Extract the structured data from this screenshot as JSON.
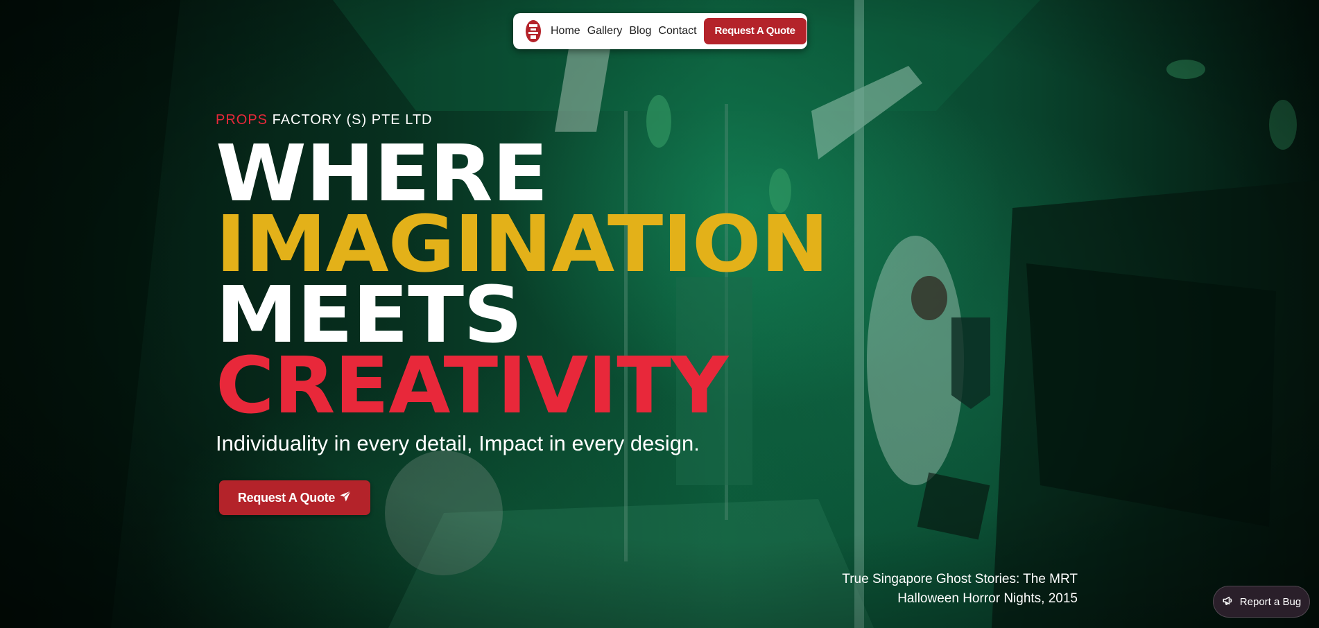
{
  "nav": {
    "logo_alt": "Props Factory logo",
    "links": [
      "Home",
      "Gallery",
      "Blog",
      "Contact"
    ],
    "cta_label": "Request A Quote"
  },
  "hero": {
    "eyebrow_accent": "PROPS",
    "eyebrow_rest": "FACTORY (S) PTE LTD",
    "headline": [
      "WHERE",
      "IMAGINATION",
      "MEETS",
      "CREATIVITY"
    ],
    "tagline": "Individuality in every detail, Impact in every design.",
    "cta_label": "Request A Quote",
    "cta_icon": "paper-plane-icon"
  },
  "caption": {
    "line1": "True Singapore Ghost Stories: The MRT",
    "line2": "Halloween Horror Nights, 2015"
  },
  "bug_button": {
    "label": "Report a Bug",
    "icon": "megaphone-icon"
  },
  "colors": {
    "brand_red": "#b4232a",
    "accent_red": "#e8283a",
    "accent_yellow": "#e3b119",
    "background_green": "#0c5a3a"
  }
}
